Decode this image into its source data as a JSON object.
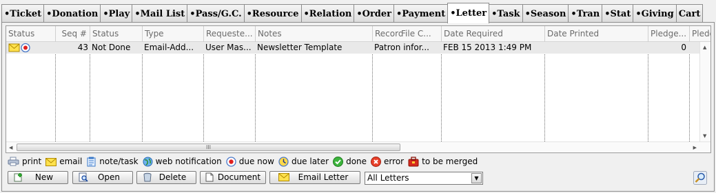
{
  "tabs": [
    {
      "label": "•Ticket",
      "active": false
    },
    {
      "label": "•Donation",
      "active": false
    },
    {
      "label": "•Play",
      "active": false
    },
    {
      "label": "•Mail List",
      "active": false
    },
    {
      "label": "•Pass/G.C.",
      "active": false
    },
    {
      "label": "•Resource",
      "active": false
    },
    {
      "label": "•Relation",
      "active": false
    },
    {
      "label": "•Order",
      "active": false
    },
    {
      "label": "•Payment",
      "active": false
    },
    {
      "label": "•Letter",
      "active": true
    },
    {
      "label": "•Task",
      "active": false
    },
    {
      "label": "•Season",
      "active": false
    },
    {
      "label": "•Tran",
      "active": false
    },
    {
      "label": "•Stat",
      "active": false
    },
    {
      "label": "•Giving",
      "active": false
    },
    {
      "label": "Cart",
      "active": false
    }
  ],
  "grid": {
    "columns": [
      "Status",
      "Seq #",
      "Status",
      "Type",
      "Requeste...",
      "Notes",
      "Records",
      "File C...",
      "Date Required",
      "Date Printed",
      "Pledge...",
      "Pledg"
    ],
    "rows": [
      {
        "status_icons": [
          "email-icon",
          "due-now-icon"
        ],
        "seq": "43",
        "status": "Not Done",
        "type": "Email-Add...",
        "requested": "User Mas...",
        "notes": "Newsletter Template",
        "records": "Patron infor...",
        "file_c": "",
        "date_required": "FEB 15 2013 1:49 PM",
        "date_printed": "",
        "pledge": "0",
        "pledg": ""
      }
    ],
    "hscroll_grip": "III"
  },
  "legend": [
    {
      "icon": "print-icon",
      "label": "print"
    },
    {
      "icon": "email-icon",
      "label": "email"
    },
    {
      "icon": "note-task-icon",
      "label": "note/task"
    },
    {
      "icon": "web-notification-icon",
      "label": "web notification"
    },
    {
      "icon": "due-now-icon",
      "label": "due now"
    },
    {
      "icon": "due-later-icon",
      "label": "due later"
    },
    {
      "icon": "done-icon",
      "label": "done"
    },
    {
      "icon": "error-icon",
      "label": "error"
    },
    {
      "icon": "to-be-merged-icon",
      "label": "to be merged"
    }
  ],
  "buttons": {
    "new": "New",
    "open": "Open",
    "delete": "Delete",
    "document": "Document",
    "email_letter": "Email Letter"
  },
  "filter": {
    "selected": "All Letters"
  },
  "colors": {
    "row_background": "#e9e9e9",
    "header_text": "#6b6b6b"
  }
}
